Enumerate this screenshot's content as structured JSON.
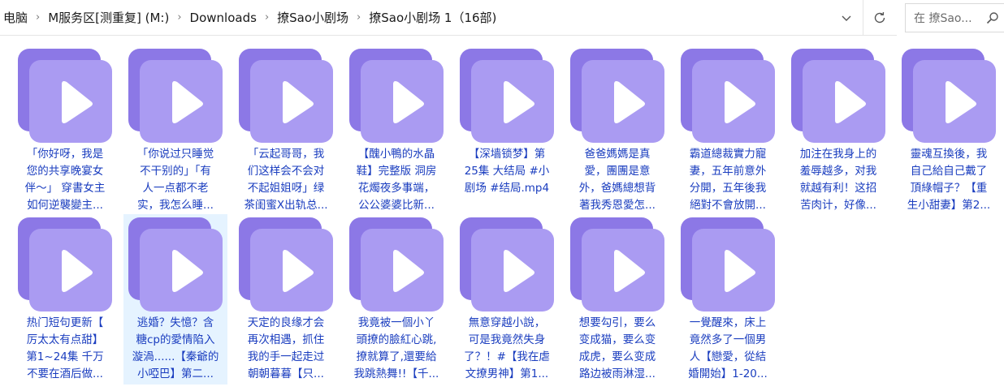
{
  "address": {
    "breadcrumbs": [
      "电脑",
      "M服务区[测重复] (M:)",
      "Downloads",
      "撩Sao小剧场",
      "撩Sao小剧场 1（16部)"
    ],
    "search_placeholder": "在 撩Sao..."
  },
  "icons": {
    "dropdown": "chevron-down-icon",
    "refresh": "refresh-icon",
    "search": "search-icon",
    "video": "video-file-icon"
  },
  "colors": {
    "icon_back": "#8c78e6",
    "icon_front": "#aa9bf2",
    "play": "#ffffff",
    "label": "#1a3dbf",
    "selected_bg": "#e5f3ff"
  },
  "files": [
    {
      "lines": [
        "「你好呀，我是",
        "您的共享晚宴女",
        "伴～」 穿書女主",
        "如何逆襲變主..."
      ]
    },
    {
      "lines": [
        "「你说过只睡觉",
        "不干别的」「有",
        "人一点都不老",
        "实，我怎么睡..."
      ]
    },
    {
      "lines": [
        "「云起哥哥，我",
        "们这样会不会对",
        "不起姐姐呀」绿",
        "茶闺蜜X出轨总..."
      ]
    },
    {
      "lines": [
        "【醜小鴨的水晶",
        "鞋】完整版  洞房",
        "花燭夜多事端，",
        "公公婆婆比新..."
      ]
    },
    {
      "lines": [
        "【深墙锁梦】第",
        "25集 大结局 #小",
        "剧场 #结局.mp4"
      ]
    },
    {
      "lines": [
        "爸爸媽媽是真",
        "愛，團團是意",
        "外，爸媽總想背",
        "著我秀恩愛怎..."
      ]
    },
    {
      "lines": [
        "霸道總裁實力寵",
        "妻，五年前意外",
        "分開，五年後我",
        "絕對不會放開..."
      ]
    },
    {
      "lines": [
        "加注在我身上的",
        "羞辱越多，对我",
        "就越有利！这招",
        "苦肉计，好像..."
      ]
    },
    {
      "lines": [
        "靈魂互換後，我",
        "自己給自己戴了",
        "頂綠帽子？【重",
        "生小甜妻】第2..."
      ]
    },
    {
      "lines": [
        "热门短句更新【",
        "厉太太有点甜】",
        "第1~24集 千万",
        "不要在酒后做..."
      ]
    },
    {
      "lines": [
        "逃婚？失憶？含",
        "糖cp的愛情陷入",
        "漩渦......【秦爺的",
        "小啞巴】第二..."
      ],
      "selected": true
    },
    {
      "lines": [
        "天定的良缘才会",
        "再次相遇，抓住",
        "我的手一起走过",
        "朝朝暮暮【只..."
      ]
    },
    {
      "lines": [
        "我竟被一個小丫",
        "頭撩的臉紅心跳,",
        "撩就算了,還要給",
        "我跳熱舞!!【千..."
      ]
    },
    {
      "lines": [
        "無意穿越小說，",
        "可是我竟然失身",
        "了？！#【我在虐",
        "文撩男神】第1..."
      ]
    },
    {
      "lines": [
        "想要勾引，要么",
        "变成猫，要么变",
        "成虎，要么变成",
        "路边被雨淋湿..."
      ]
    },
    {
      "lines": [
        "一覺醒來，床上",
        "竟然多了一個男",
        "人【戀愛，從結",
        "婚開始】1-20..."
      ]
    }
  ]
}
